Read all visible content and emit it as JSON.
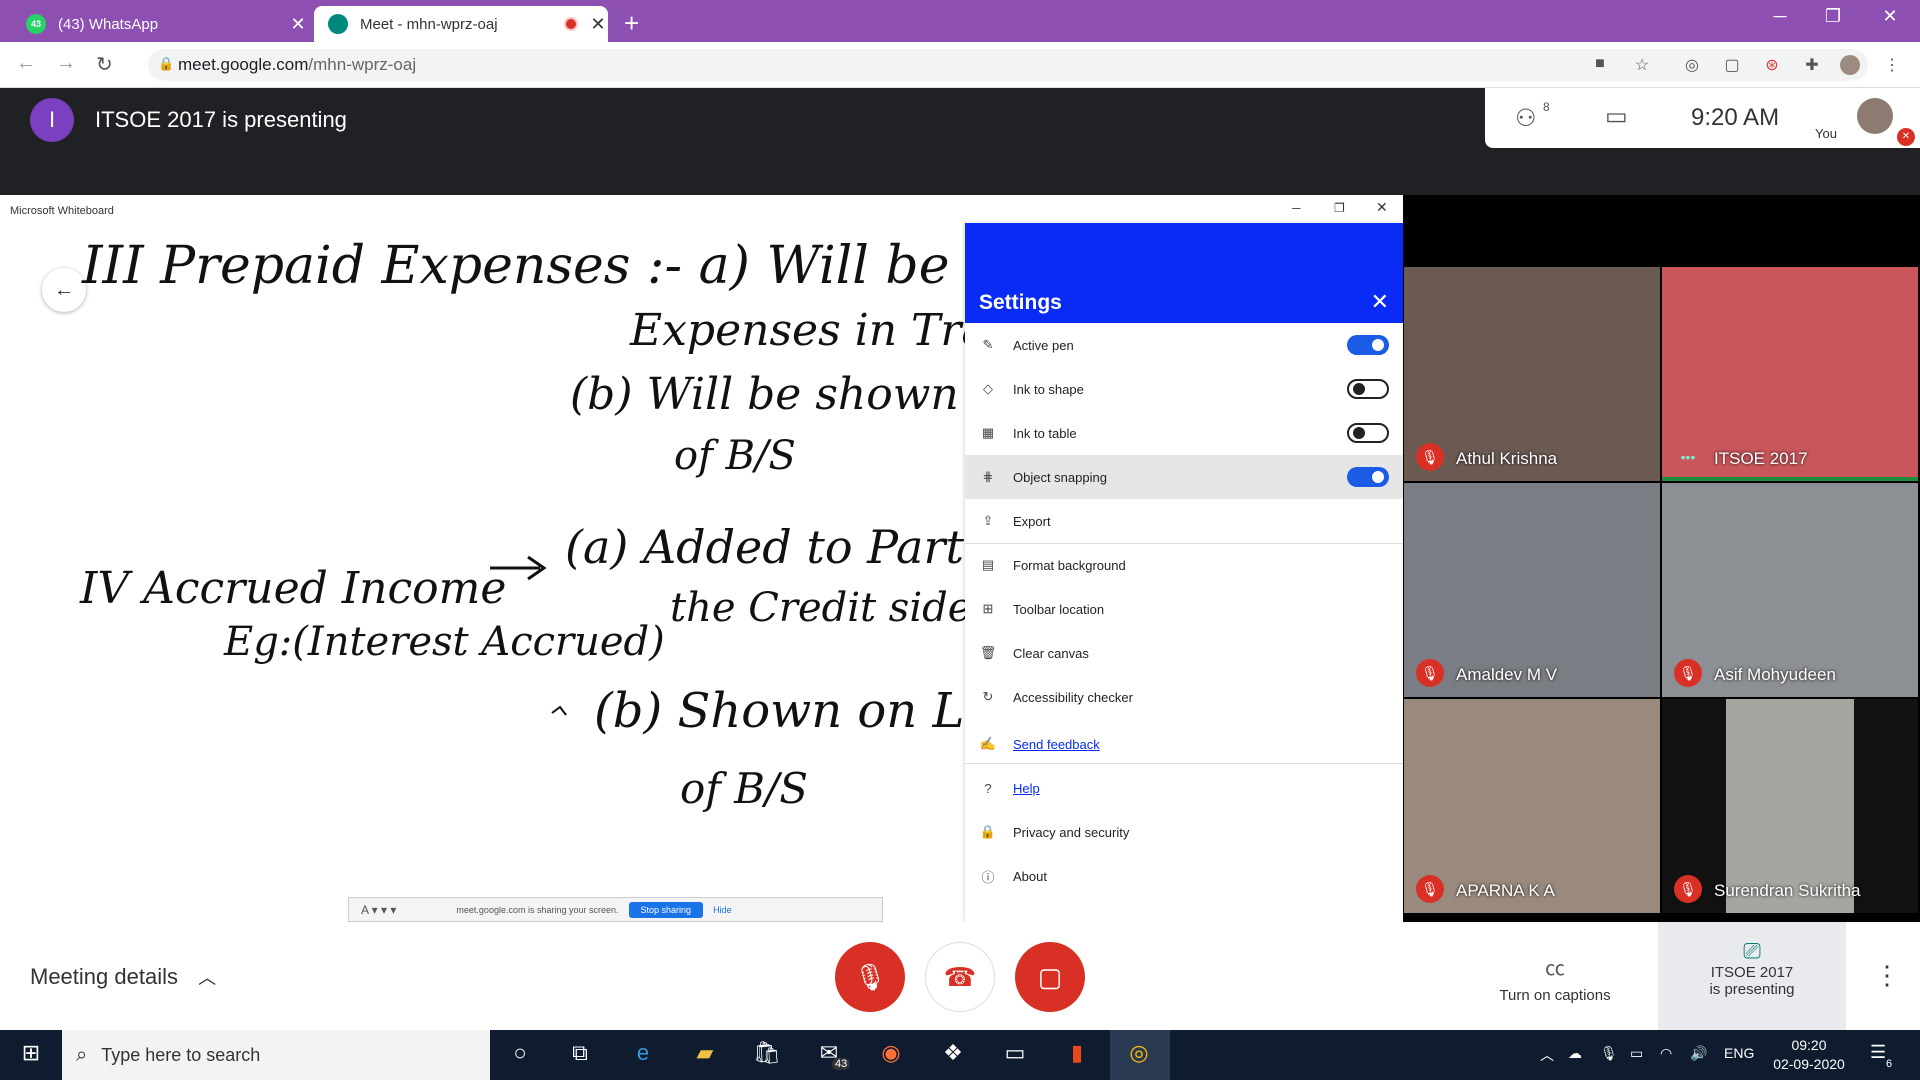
{
  "browser": {
    "tabs": [
      {
        "label": "(43) WhatsApp",
        "favicon_badge": "43",
        "color": "#25d366"
      },
      {
        "label": "Meet - mhn-wprz-oaj",
        "color": "#00897b"
      }
    ],
    "new_tab_label": "+",
    "url_host": "meet.google.com",
    "url_path": "/mhn-wprz-oaj"
  },
  "meet": {
    "presenter_initial": "I",
    "presenting_title": "ITSOE 2017 is presenting",
    "participant_count": "8",
    "time": "9:20 AM",
    "you_label": "You"
  },
  "whiteboard": {
    "window_title": "Microsoft Whiteboard",
    "share_bar": {
      "notice": "meet.google.com is sharing your screen.",
      "stop_label": "Stop sharing",
      "hide_label": "Hide"
    },
    "handwriting": [
      "III Prepaid Expenses :- a) Will be deducted f",
      "Expenses in Trading",
      "(b) Will be shown o",
      "of B/S",
      "IV Accrued Income",
      "Eg:(Interest Accrued)",
      "(a) Added to Particul",
      "the Credit side",
      "(b) Shown on L",
      "of B/S"
    ]
  },
  "settings": {
    "title": "Settings",
    "items": [
      {
        "label": "Active pen",
        "icon": "pen-icon",
        "glyph": "✎",
        "toggle": "on"
      },
      {
        "label": "Ink to shape",
        "icon": "shape-icon",
        "glyph": "◇",
        "toggle": "off"
      },
      {
        "label": "Ink to table",
        "icon": "table-icon",
        "glyph": "▦",
        "toggle": "off"
      },
      {
        "label": "Object snapping",
        "icon": "snap-icon",
        "glyph": "⋕",
        "toggle": "on"
      },
      {
        "label": "Export",
        "icon": "export-icon",
        "glyph": "⇪"
      },
      {
        "label": "Format background",
        "icon": "background-icon",
        "glyph": "▤"
      },
      {
        "label": "Toolbar location",
        "icon": "toolbar-icon",
        "glyph": "⊞"
      },
      {
        "label": "Clear canvas",
        "icon": "trash-icon",
        "glyph": "🗑"
      },
      {
        "label": "Accessibility checker",
        "icon": "accessibility-icon",
        "glyph": "↻"
      },
      {
        "label": "Send feedback",
        "icon": "feedback-icon",
        "glyph": "✍",
        "link": true
      },
      {
        "label": "Help",
        "icon": "help-icon",
        "glyph": "?",
        "link": true
      },
      {
        "label": "Privacy and security",
        "icon": "lock-icon",
        "glyph": "🔒"
      },
      {
        "label": "About",
        "icon": "info-icon",
        "glyph": "ⓘ"
      }
    ]
  },
  "participants": [
    {
      "name": "Athul Krishna",
      "muted": true,
      "bg": "#6b5a52"
    },
    {
      "name": "ITSOE 2017",
      "muted": false,
      "bg": "#c9565a"
    },
    {
      "name": "Amaldev M V",
      "muted": true,
      "bg": "#7a7d83"
    },
    {
      "name": "Asif Mohyudeen",
      "muted": true,
      "bg": "#8c8f93"
    },
    {
      "name": "APARNA K A",
      "muted": true,
      "bg": "#9a8a7e"
    },
    {
      "name": "Surendran Sukritha",
      "muted": true,
      "bg": "#b8b6b0"
    }
  ],
  "bottom": {
    "meeting_details": "Meeting details",
    "captions": "Turn on captions",
    "presenting_line1": "ITSOE 2017",
    "presenting_line2": "is presenting"
  },
  "taskbar": {
    "search_placeholder": "Type here to search",
    "mail_badge": "43",
    "language": "ENG",
    "time": "09:20",
    "date": "02-09-2020",
    "notifications": "6"
  }
}
